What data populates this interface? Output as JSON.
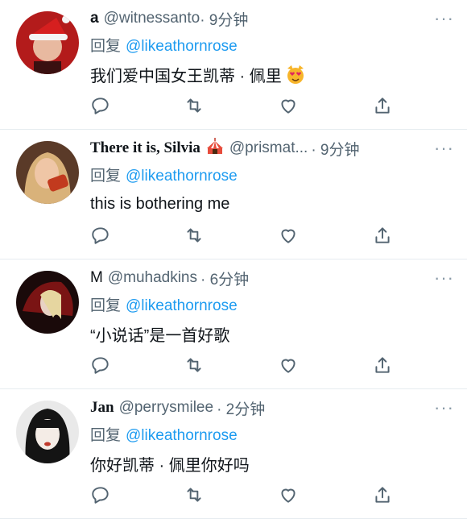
{
  "reply_label": "回复",
  "more_label": "···",
  "tweets": [
    {
      "name": "a",
      "handle": "@witnessanto",
      "time": "· 9分钟",
      "reply_to": "@likeathornrose",
      "text": "我们爱中国女王凯蒂 · 佩里",
      "text_emoji": "heart-eyes-cat-emoji"
    },
    {
      "name": "There it is, Silvia",
      "name_emoji": "circus-tent-emoji",
      "handle": "@prismat...",
      "time": "· 9分钟",
      "reply_to": "@likeathornrose",
      "text": "this is bothering me"
    },
    {
      "name": "M",
      "handle": "@muhadkins",
      "time": "· 6分钟",
      "reply_to": "@likeathornrose",
      "text": "“小说话”是一首好歌"
    },
    {
      "name": "Jan",
      "handle": "@perrysmilee",
      "time": "· 2分钟",
      "reply_to": "@likeathornrose",
      "text": "你好凯蒂 · 佩里你好吗"
    }
  ],
  "colors": {
    "link": "#1d9bf0",
    "muted": "#536471",
    "icon": "#536471",
    "divider": "#e6ecf0"
  }
}
